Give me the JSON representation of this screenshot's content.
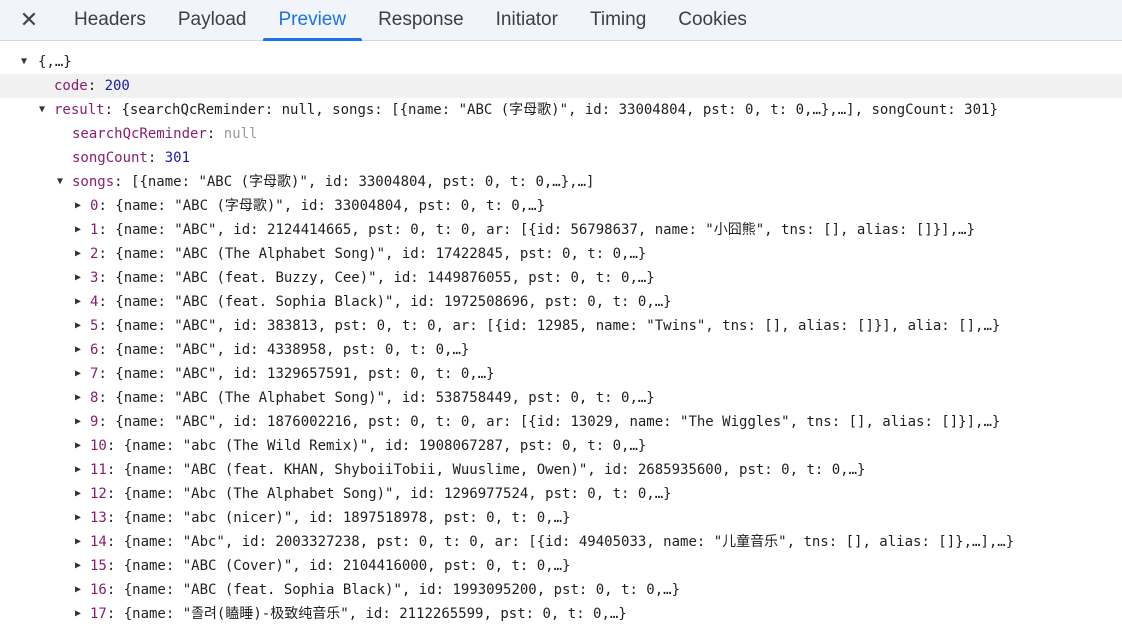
{
  "tabs": {
    "close_glyph": "✕",
    "items": [
      "Headers",
      "Payload",
      "Preview",
      "Response",
      "Initiator",
      "Timing",
      "Cookies"
    ],
    "active": "Preview"
  },
  "tree": {
    "root_summary": "{,…}",
    "code": {
      "key": "code",
      "value": "200"
    },
    "result": {
      "key": "result",
      "summary": "{searchQcReminder: null, songs: [{name: \"ABC (字母歌)\", id: 33004804, pst: 0, t: 0,…},…], songCount: 301}",
      "searchQcReminder": {
        "key": "searchQcReminder",
        "value": "null"
      },
      "songCount": {
        "key": "songCount",
        "value": "301"
      },
      "songs": {
        "key": "songs",
        "summary": "[{name: \"ABC (字母歌)\", id: 33004804, pst: 0, t: 0,…},…]",
        "items": [
          {
            "index": "0",
            "summary": "{name: \"ABC (字母歌)\", id: 33004804, pst: 0, t: 0,…}"
          },
          {
            "index": "1",
            "summary": "{name: \"ABC\", id: 2124414665, pst: 0, t: 0, ar: [{id: 56798637, name: \"小囧熊\", tns: [], alias: []}],…}"
          },
          {
            "index": "2",
            "summary": "{name: \"ABC (The Alphabet Song)\", id: 17422845, pst: 0, t: 0,…}"
          },
          {
            "index": "3",
            "summary": "{name: \"ABC (feat. Buzzy, Cee)\", id: 1449876055, pst: 0, t: 0,…}"
          },
          {
            "index": "4",
            "summary": "{name: \"ABC (feat. Sophia Black)\", id: 1972508696, pst: 0, t: 0,…}"
          },
          {
            "index": "5",
            "summary": "{name: \"ABC\", id: 383813, pst: 0, t: 0, ar: [{id: 12985, name: \"Twins\", tns: [], alias: []}], alia: [],…}"
          },
          {
            "index": "6",
            "summary": "{name: \"ABC\", id: 4338958, pst: 0, t: 0,…}"
          },
          {
            "index": "7",
            "summary": "{name: \"ABC\", id: 1329657591, pst: 0, t: 0,…}"
          },
          {
            "index": "8",
            "summary": "{name: \"ABC (The Alphabet Song)\", id: 538758449, pst: 0, t: 0,…}"
          },
          {
            "index": "9",
            "summary": "{name: \"ABC\", id: 1876002216, pst: 0, t: 0, ar: [{id: 13029, name: \"The Wiggles\", tns: [], alias: []}],…}"
          },
          {
            "index": "10",
            "summary": "{name: \"abc (The Wild Remix)\", id: 1908067287, pst: 0, t: 0,…}"
          },
          {
            "index": "11",
            "summary": "{name: \"ABC (feat. KHAN, ShyboiiTobii, Wuuslime, Owen)\", id: 2685935600, pst: 0, t: 0,…}"
          },
          {
            "index": "12",
            "summary": "{name: \"Abc (The Alphabet Song)\", id: 1296977524, pst: 0, t: 0,…}"
          },
          {
            "index": "13",
            "summary": "{name: \"abc (nicer)\", id: 1897518978, pst: 0, t: 0,…}"
          },
          {
            "index": "14",
            "summary": "{name: \"Abc\", id: 2003327238, pst: 0, t: 0, ar: [{id: 49405033, name: \"儿童音乐\", tns: [], alias: []},…],…}"
          },
          {
            "index": "15",
            "summary": "{name: \"ABC (Cover)\", id: 2104416000, pst: 0, t: 0,…}"
          },
          {
            "index": "16",
            "summary": "{name: \"ABC (feat. Sophia Black)\", id: 1993095200, pst: 0, t: 0,…}"
          },
          {
            "index": "17",
            "summary": "{name: \"졸려(瞌睡)-极致纯音乐\", id: 2112265599, pst: 0, t: 0,…}"
          }
        ]
      }
    }
  },
  "colors": {
    "accent": "#1a73e8",
    "key": "#8a1e6e",
    "number": "#1a1aa6",
    "null": "#9a9a9a",
    "tabbar_bg": "#f1f4f8",
    "highlight_row": "#f1f1f1"
  }
}
